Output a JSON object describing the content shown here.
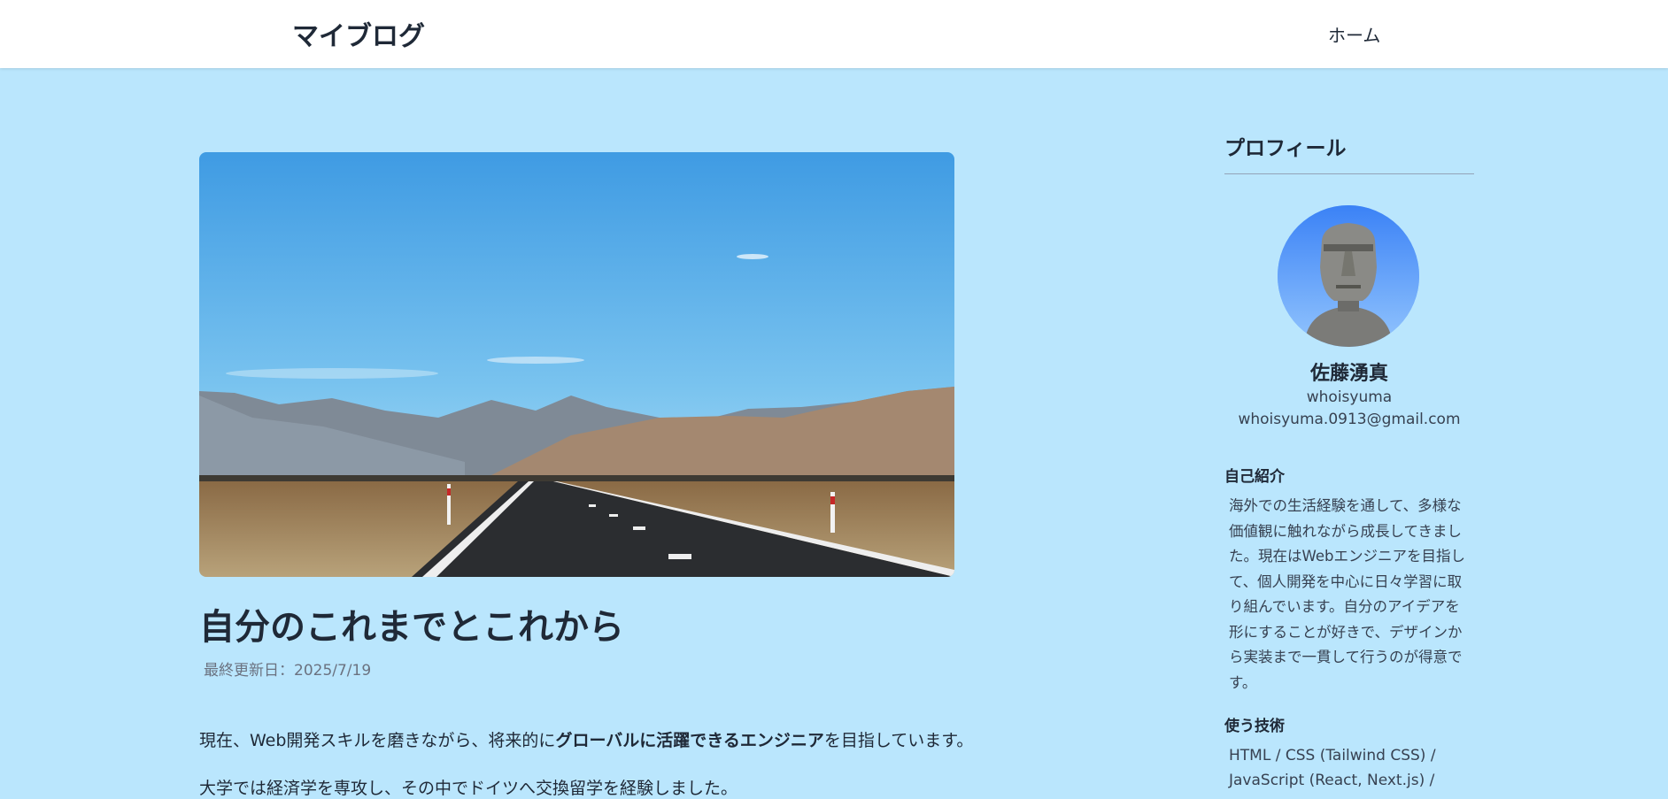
{
  "header": {
    "site_title": "マイブログ",
    "nav_home": "ホーム"
  },
  "post": {
    "title": "自分のこれまでとこれから",
    "updated": "最終更新日：2025/7/19",
    "paragraph1_before": "現在、Web開発スキルを磨きながら、将来的に",
    "paragraph1_bold": "グローバルに活躍できるエンジニア",
    "paragraph1_after": "を目指しています。",
    "paragraph2": "大学では経済学を専攻し、その中でドイツへ交換留学を経験しました。"
  },
  "sidebar": {
    "heading": "プロフィール",
    "name": "佐藤湧真",
    "handle": "whoisyuma",
    "email": "whoisyuma.0913@gmail.com",
    "intro_heading": "自己紹介",
    "intro_text": "海外での生活経験を通して、多様な価値観に触れながら成長してきました。現在はWebエンジニアを目指して、個人開発を中心に日々学習に取り組んでいます。自分のアイデアを形にすることが好きで、デザインから実装まで一貫して行うのが得意です。",
    "tech_heading": "使う技術",
    "tech_text": "HTML / CSS (Tailwind CSS) / JavaScript (React, Next.js) /"
  },
  "colors": {
    "page_background": "#bae6fd",
    "header_background": "#ffffff",
    "text": "#1f2937"
  }
}
